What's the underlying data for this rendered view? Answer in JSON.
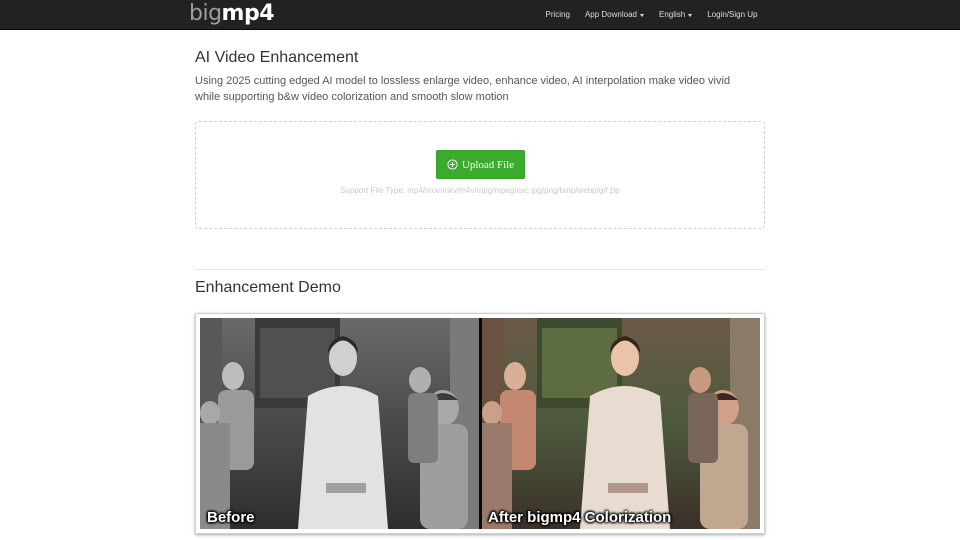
{
  "navbar": {
    "logo_part1": "big",
    "logo_part2": "mp4",
    "items": [
      {
        "label": "Pricing",
        "dropdown": false
      },
      {
        "label": "App Download",
        "dropdown": true
      },
      {
        "label": "English",
        "dropdown": true
      },
      {
        "label": "Login/Sign Up",
        "dropdown": false
      }
    ]
  },
  "main": {
    "title": "AI Video Enhancement",
    "description": "Using 2025 cutting edged AI model to lossless enlarge video, enhance video, AI interpolation make video vivid while supporting b&w video colorization and smooth slow motion",
    "upload": {
      "button_label": "Upload File",
      "button_icon": "plus-circle-icon",
      "support_text": "Support File Type: mp4/mov/mkv/m4v/mpg/mpeg/avc jpg/png/bmp/webp/gif zip"
    }
  },
  "demo": {
    "title": "Enhancement Demo",
    "before_label": "Before",
    "after_label": "After bigmp4 Colorization"
  },
  "colors": {
    "navbar_bg": "#222222",
    "upload_button": "#3bab2d"
  }
}
